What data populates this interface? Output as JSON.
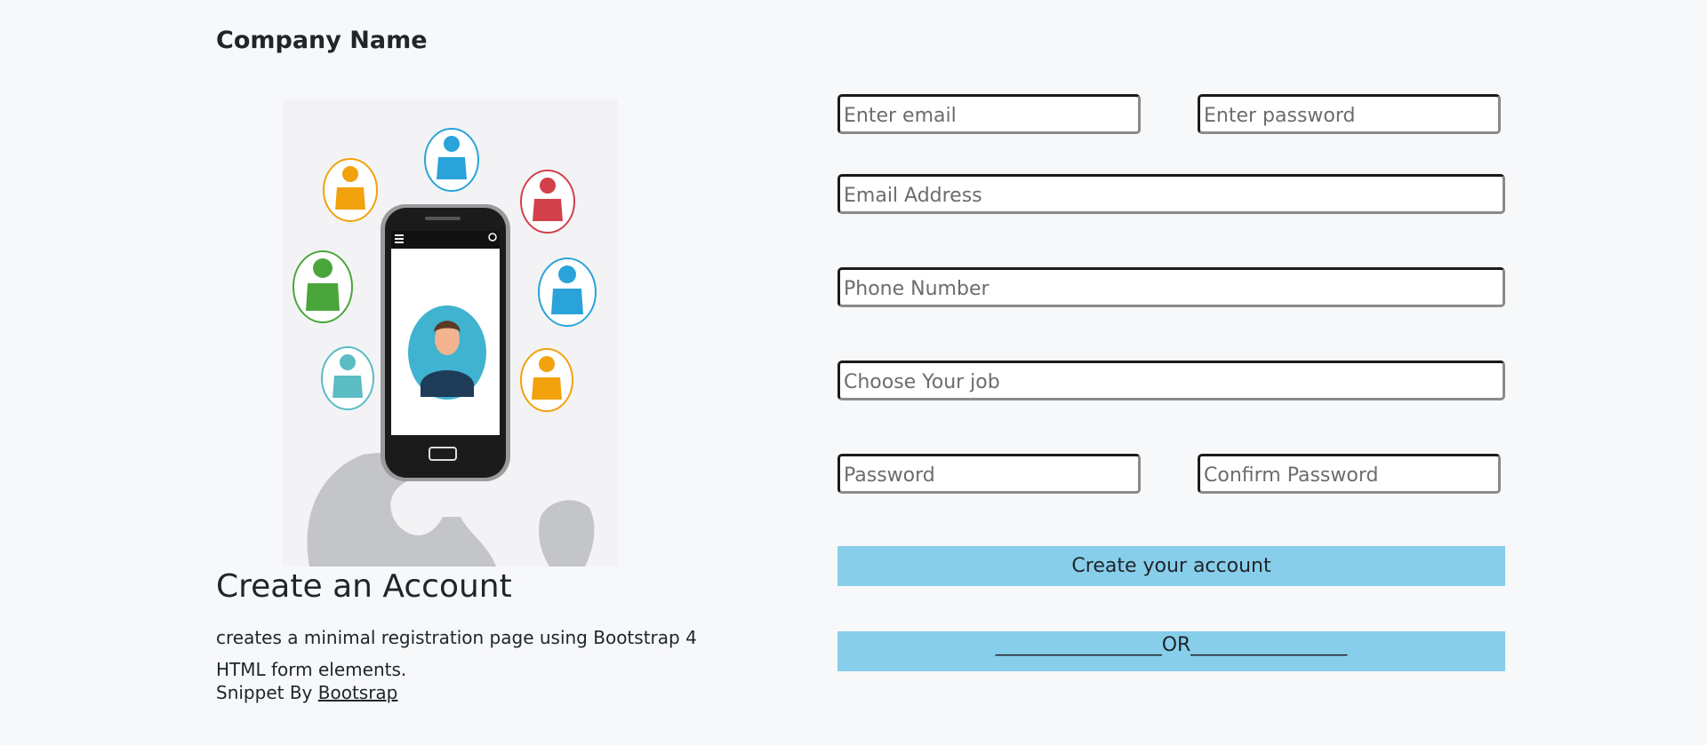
{
  "header": {
    "brand": "Company Name"
  },
  "intro": {
    "title": "Create an Account",
    "description": "creates a minimal registration page using Bootstrap 4 HTML form elements.",
    "snippet_prefix": "Snippet By",
    "snippet_link": "Bootsrap"
  },
  "form": {
    "login_email_placeholder": "Enter email",
    "login_password_placeholder": "Enter password",
    "email_placeholder": "Email Address",
    "phone_placeholder": "Phone Number",
    "job_placeholder": "Choose Your job",
    "password_placeholder": "Password",
    "confirm_password_placeholder": "Confirm Password",
    "create_button": "Create your account",
    "or_divider": "_________________OR________________"
  },
  "colors": {
    "background": "#f7f8fa",
    "button_bg": "#87ceeb"
  },
  "icons": [
    "phone-illustration",
    "person-icon",
    "globe-illustration"
  ]
}
